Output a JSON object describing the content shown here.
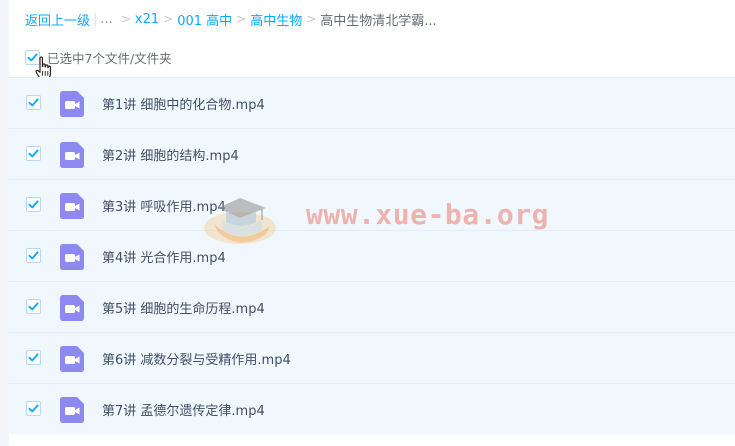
{
  "breadcrumb": {
    "back": "返回上一级",
    "ellipsis": "...",
    "items": [
      "x21",
      "001 高中",
      "高中生物"
    ],
    "current": "高中生物清北学霸..."
  },
  "selection": {
    "text": "已选中7个文件/文件夹",
    "checked": true
  },
  "files": [
    {
      "name": "第1讲 细胞中的化合物.mp4",
      "checked": true,
      "icon": "video-file-icon"
    },
    {
      "name": "第2讲 细胞的结构.mp4",
      "checked": true,
      "icon": "video-file-icon"
    },
    {
      "name": "第3讲 呼吸作用.mp4",
      "checked": true,
      "icon": "video-file-icon"
    },
    {
      "name": "第4讲 光合作用.mp4",
      "checked": true,
      "icon": "video-file-icon"
    },
    {
      "name": "第5讲 细胞的生命历程.mp4",
      "checked": true,
      "icon": "video-file-icon"
    },
    {
      "name": "第6讲 减数分裂与受精作用.mp4",
      "checked": true,
      "icon": "video-file-icon"
    },
    {
      "name": "第7讲 孟德尔遗传定律.mp4",
      "checked": true,
      "icon": "video-file-icon"
    }
  ],
  "watermark": {
    "text": "www.xue-ba.org",
    "icon": "graduation-cap-logo"
  },
  "colors": {
    "link": "#09aaff",
    "row_bg": "#f0f8fe",
    "checkbox": "#06a7ff",
    "video_icon": "#8e88f1"
  }
}
